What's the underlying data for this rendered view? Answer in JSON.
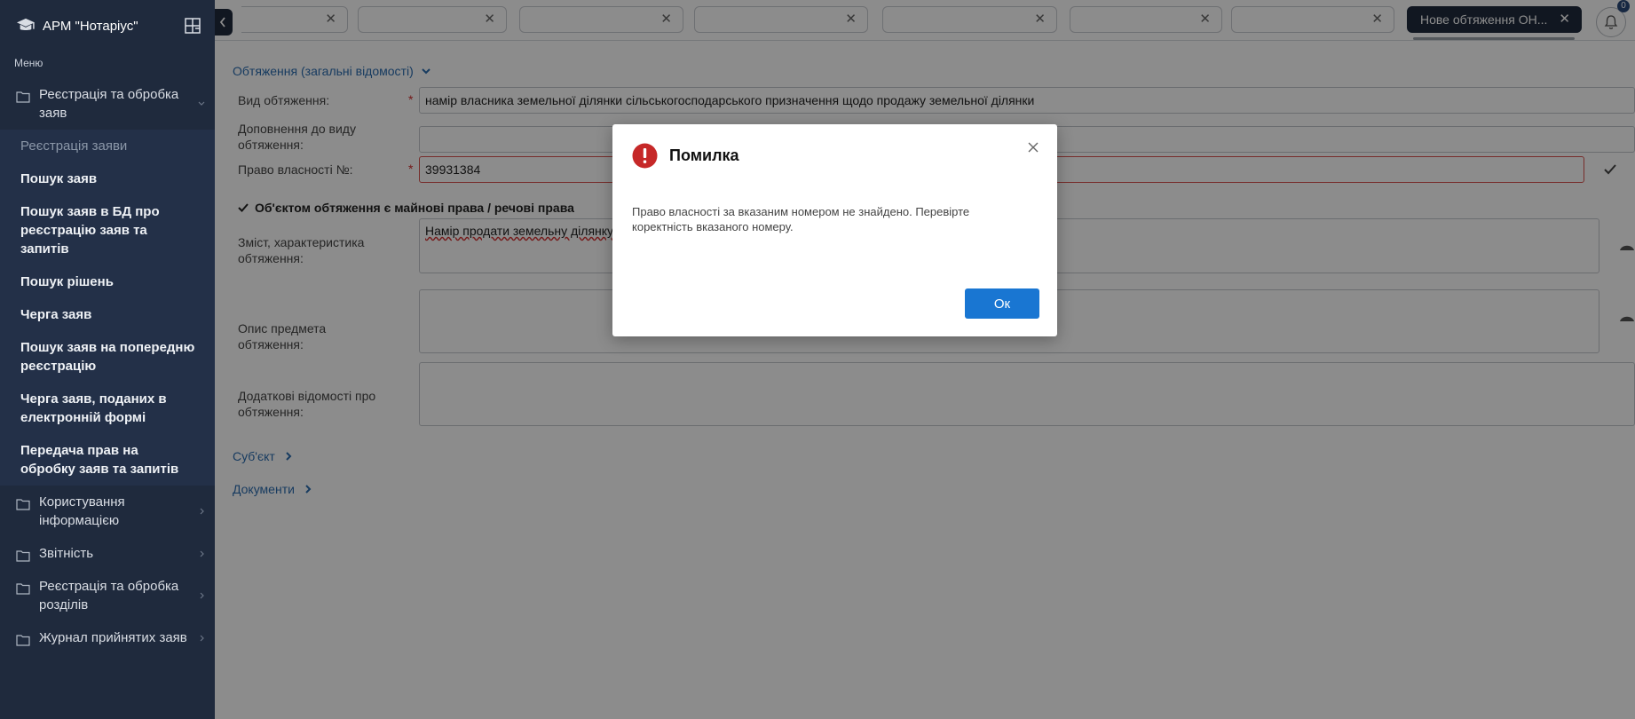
{
  "app": {
    "title": "АРМ \"Нотаріус\""
  },
  "sidebar": {
    "menu_label": "Меню",
    "groups": [
      {
        "label": "Реєстрація та обробка заяв"
      },
      {
        "label": "Користування інформацією"
      },
      {
        "label": "Звітність"
      },
      {
        "label": "Реєстрація та обробка розділів"
      },
      {
        "label": "Журнал прийнятих заяв"
      }
    ],
    "sub_items": [
      {
        "label": "Реєстрація заяви",
        "active": true
      },
      {
        "label": "Пошук заяв"
      },
      {
        "label": "Пошук заяв в БД про реєстрацію заяв та запитів"
      },
      {
        "label": "Пошук рішень"
      },
      {
        "label": "Черга заяв"
      },
      {
        "label": "Пошук заяв на попередню реєстрацію"
      },
      {
        "label": "Черга заяв, поданих в електронній формі"
      },
      {
        "label": "Передача прав на обробку заяв та запитів"
      }
    ]
  },
  "tabs": {
    "active_label": "Нове обтяження ОН...",
    "notification_count": "0"
  },
  "form": {
    "section_title": "Обтяження (загальні відомості)",
    "encumbrance_type_label": "Вид обтяження:",
    "encumbrance_type_value": "намір власника земельної ділянки сільськогосподарського призначення щодо продажу земельної ділянки",
    "type_addition_label": "Доповнення до виду обтяження:",
    "ownership_right_label": "Право власності №:",
    "ownership_right_value": "39931384",
    "checkbox_label": "Об'єктом обтяження є майнові права / речові права",
    "content_label": "Зміст, характеристика обтяження:",
    "content_value": "Намір продати земельну ділянку",
    "subject_desc_label": "Опис предмета обтяження:",
    "additional_label": "Додаткові відомості про обтяження:",
    "required_mark": "*",
    "subject_section": "Суб'єкт",
    "documents_section": "Документи"
  },
  "dialog": {
    "title": "Помилка",
    "message": "Право власності за вказаним номером не знайдено. Перевірте коректність вказаного номеру.",
    "ok_label": "Ок"
  },
  "colors": {
    "sidebar_bg": "#1f2a3d",
    "accent": "#1976d2",
    "link": "#2b6cb0",
    "error": "#c62828"
  }
}
